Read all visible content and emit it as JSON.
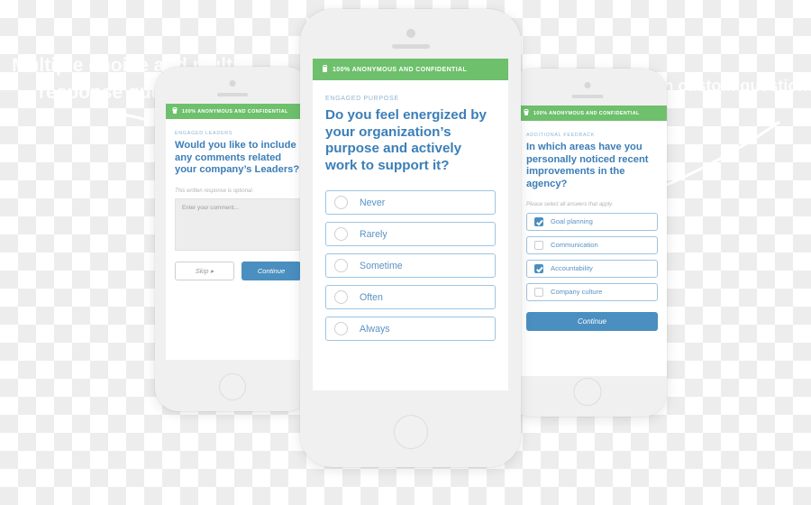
{
  "background": {
    "watermark_left": "Multiple choice and multi-response questions",
    "watermark_right": "Write your own custom questions"
  },
  "colors": {
    "green_header": "#6ec06c",
    "heading_blue": "#3b7eb8",
    "option_blue": "#5a93c4",
    "primary_button": "#4a8fc0",
    "eyebrow_gray_blue": "#8fb4d3"
  },
  "phones": {
    "left": {
      "header_text": "100% ANONYMOUS AND CONFIDENTIAL",
      "eyebrow": "ENGAGED LEADERS",
      "question": "Would you like to include any comments related your company’s Leaders?",
      "note": "This written response is optional.",
      "textarea_placeholder": "Enter your comment...",
      "skip_label": "Skip ▸",
      "continue_label": "Continue"
    },
    "center": {
      "header_text": "100% ANONYMOUS AND CONFIDENTIAL",
      "eyebrow": "ENGAGED PURPOSE",
      "question": "Do you feel energized by your organization’s purpose and actively work to support it?",
      "options": [
        {
          "label": "Never",
          "selected": false
        },
        {
          "label": "Rarely",
          "selected": false
        },
        {
          "label": "Sometime",
          "selected": false
        },
        {
          "label": "Often",
          "selected": false
        },
        {
          "label": "Always",
          "selected": false
        }
      ]
    },
    "right": {
      "header_text": "100% ANONYMOUS AND CONFIDENTIAL",
      "eyebrow": "ADDITIONAL FEEDBACK",
      "question": "In which areas have you personally noticed recent improvements in the agency?",
      "note": "Please select all answers that apply.",
      "options": [
        {
          "label": "Goal planning",
          "checked": true
        },
        {
          "label": "Communication",
          "checked": false
        },
        {
          "label": "Accountability",
          "checked": true
        },
        {
          "label": "Company culture",
          "checked": false
        }
      ],
      "continue_label": "Continue"
    }
  }
}
